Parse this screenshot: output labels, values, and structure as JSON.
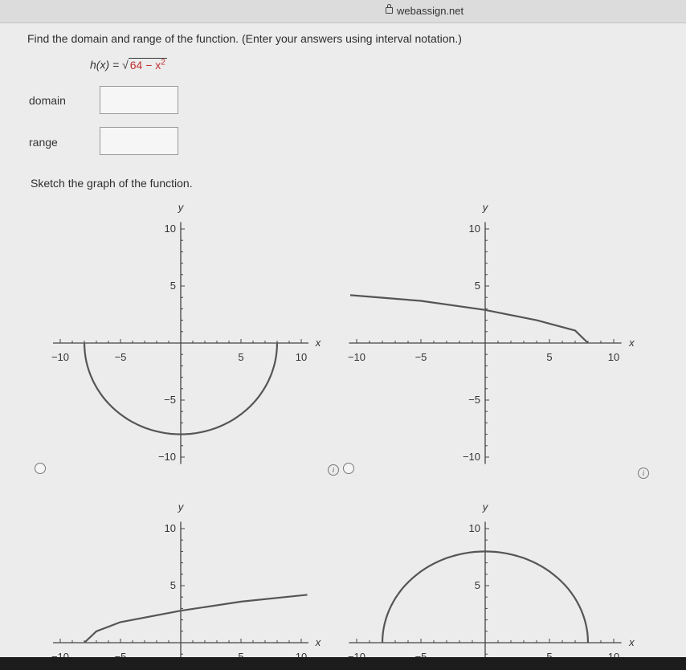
{
  "browser": {
    "url": "webassign.net"
  },
  "question": {
    "prompt": "Find the domain and range of the function. (Enter your answers using interval notation.)",
    "function_lhs": "h(x) = ",
    "function_radicand": "64 − x",
    "function_exp": "2",
    "domain_label": "domain",
    "range_label": "range",
    "domain_value": "",
    "range_value": "",
    "sketch_prompt": "Sketch the graph of the function."
  },
  "graphs": {
    "axis_x_label": "x",
    "axis_y_label": "y",
    "tick_labels_x": [
      "−10",
      "−5",
      "5",
      "10"
    ],
    "tick_labels_y": [
      "10",
      "5",
      "−5",
      "−10"
    ],
    "info_icon": "i"
  },
  "chart_data": [
    {
      "type": "line",
      "name": "choice-a",
      "description": "lower semicircle",
      "x": [
        -8,
        -6,
        -4,
        -2,
        0,
        2,
        4,
        6,
        8
      ],
      "y": [
        0,
        -5.29,
        -6.93,
        -7.75,
        -8,
        -7.75,
        -6.93,
        -5.29,
        0
      ],
      "xlim": [
        -10,
        10
      ],
      "ylim": [
        -10,
        10
      ]
    },
    {
      "type": "line",
      "name": "choice-b",
      "x": [
        -10.5,
        -5,
        0,
        4,
        7,
        8
      ],
      "y": [
        4.2,
        3.7,
        2.9,
        2.0,
        1.1,
        0
      ],
      "xlim": [
        -10,
        10
      ],
      "ylim": [
        -10,
        10
      ]
    },
    {
      "type": "line",
      "name": "choice-c",
      "x": [
        -8,
        -7,
        -5,
        0,
        5,
        10.5
      ],
      "y": [
        0,
        1.0,
        1.8,
        2.8,
        3.6,
        4.2
      ],
      "xlim": [
        -10,
        10
      ],
      "ylim": [
        -10,
        10
      ]
    },
    {
      "type": "line",
      "name": "choice-d",
      "description": "upper semicircle",
      "x": [
        -8,
        -6,
        -4,
        -2,
        0,
        2,
        4,
        6,
        8
      ],
      "y": [
        0,
        5.29,
        6.93,
        7.75,
        8,
        7.75,
        6.93,
        5.29,
        0
      ],
      "xlim": [
        -10,
        10
      ],
      "ylim": [
        -10,
        10
      ]
    }
  ]
}
